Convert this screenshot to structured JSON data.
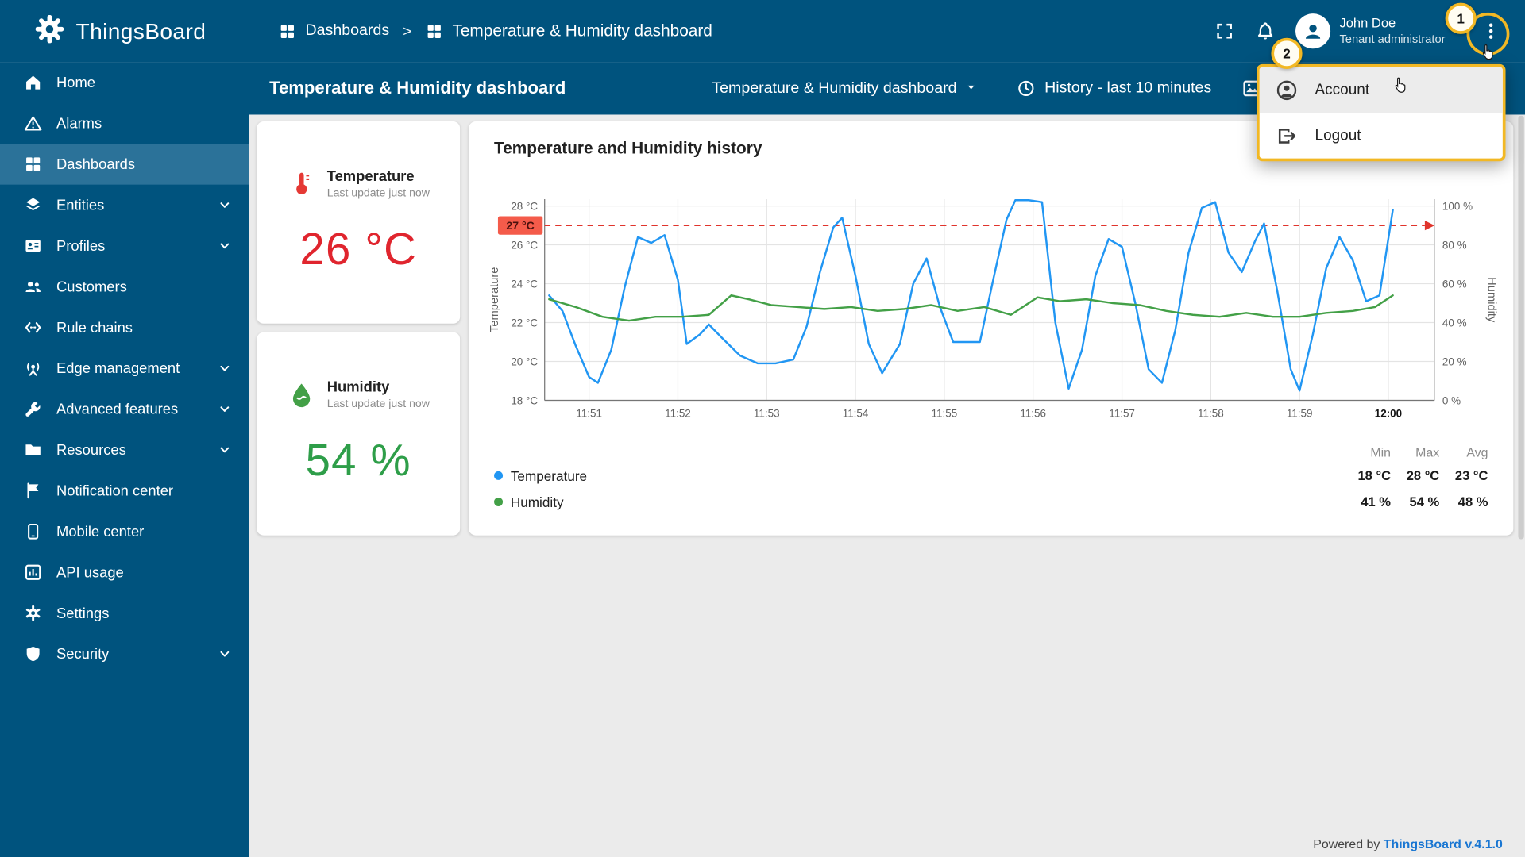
{
  "theme": {
    "primary": "#00537e",
    "sidebar_selected": "#2b7299",
    "annotation": "#f2b824",
    "content_bg": "#ebebeb",
    "link": "#1976d2"
  },
  "app": {
    "name": "ThingsBoard",
    "footer_powered": "Powered by",
    "footer_version": "ThingsBoard v.4.1.0"
  },
  "header": {
    "breadcrumb": [
      {
        "label": "Dashboards",
        "icon": "dashboards"
      },
      {
        "label": "Temperature & Humidity dashboard",
        "icon": "dashboards"
      }
    ],
    "user": {
      "name": "John Doe",
      "role": "Tenant administrator"
    }
  },
  "sidebar": {
    "items": [
      {
        "label": "Home",
        "icon": "home"
      },
      {
        "label": "Alarms",
        "icon": "alarms"
      },
      {
        "label": "Dashboards",
        "icon": "dashboards",
        "selected": true
      },
      {
        "label": "Entities",
        "icon": "entities",
        "expandable": true
      },
      {
        "label": "Profiles",
        "icon": "profiles",
        "expandable": true
      },
      {
        "label": "Customers",
        "icon": "customers"
      },
      {
        "label": "Rule chains",
        "icon": "rule-chains"
      },
      {
        "label": "Edge management",
        "icon": "edge-management",
        "expandable": true
      },
      {
        "label": "Advanced features",
        "icon": "advanced-features",
        "expandable": true
      },
      {
        "label": "Resources",
        "icon": "resources",
        "expandable": true
      },
      {
        "label": "Notification center",
        "icon": "notification-center"
      },
      {
        "label": "Mobile center",
        "icon": "mobile-center"
      },
      {
        "label": "API usage",
        "icon": "api-usage"
      },
      {
        "label": "Settings",
        "icon": "settings"
      },
      {
        "label": "Security",
        "icon": "security",
        "expandable": true
      }
    ]
  },
  "toolbar": {
    "title": "Temperature & Humidity dashboard",
    "dashboard_select": "Temperature & Humidity dashboard",
    "time_window": "History - last 10 minutes"
  },
  "user_menu": {
    "highlighted_index": 0,
    "items": [
      {
        "label": "Account",
        "icon": "account"
      },
      {
        "label": "Logout",
        "icon": "logout"
      }
    ]
  },
  "annotations": {
    "step1": "1",
    "step2": "2"
  },
  "cards": {
    "temperature": {
      "title": "Temperature",
      "subtitle": "Last update just now",
      "value": "26 °C",
      "color": "#e0252e",
      "icon_color": "#e53935"
    },
    "humidity": {
      "title": "Humidity",
      "subtitle": "Last update just now",
      "value": "54 %",
      "color": "#2e9e49",
      "icon_color": "#43a047"
    }
  },
  "chart_card": {
    "title": "Temperature and Humidity history",
    "legend": {
      "headers": [
        "Min",
        "Max",
        "Avg"
      ],
      "rows": [
        {
          "label": "Temperature",
          "color": "#2196f3",
          "min": "18 °C",
          "max": "28 °C",
          "avg": "23 °C"
        },
        {
          "label": "Humidity",
          "color": "#43a047",
          "min": "41 %",
          "max": "54 %",
          "avg": "48 %"
        }
      ]
    }
  },
  "chart_data": {
    "type": "line",
    "title": "Temperature and Humidity history",
    "x_unit": "minutes relative to 11:51",
    "x_range": [
      -0.5,
      9.52
    ],
    "x_ticks": [
      {
        "x": 0,
        "label": "11:51"
      },
      {
        "x": 1,
        "label": "11:52"
      },
      {
        "x": 2,
        "label": "11:53"
      },
      {
        "x": 3,
        "label": "11:54"
      },
      {
        "x": 4,
        "label": "11:55"
      },
      {
        "x": 5,
        "label": "11:56"
      },
      {
        "x": 6,
        "label": "11:57"
      },
      {
        "x": 7,
        "label": "11:58"
      },
      {
        "x": 8,
        "label": "11:59"
      },
      {
        "x": 9,
        "label": "12:00",
        "bold": true
      }
    ],
    "left_axis": {
      "label": "Temperature",
      "min": 18,
      "max": 28.35,
      "tick_values": [
        18,
        20,
        22,
        24,
        26,
        28
      ],
      "tick_labels": [
        "18 °C",
        "20 °C",
        "22 °C",
        "24 °C",
        "26 °C",
        "28 °C"
      ]
    },
    "right_axis": {
      "label": "Humidity",
      "min": 0,
      "max": 103.5,
      "tick_values": [
        0,
        20,
        40,
        60,
        80,
        100
      ],
      "tick_labels": [
        "0 %",
        "20 %",
        "40 %",
        "60 %",
        "80 %",
        "100 %"
      ]
    },
    "threshold": {
      "value": 27,
      "label": "27 °C",
      "color": "#e0342c",
      "badge_bg": "#f45b4a",
      "badge_text": "#4a100d"
    },
    "grid": true,
    "legend_position": "bottom",
    "series": [
      {
        "name": "Temperature",
        "unit": "°C",
        "axis": "left",
        "color": "#2196f3",
        "x": [
          -0.45,
          -0.3,
          -0.15,
          0,
          0.1,
          0.25,
          0.4,
          0.55,
          0.7,
          0.85,
          1,
          1.1,
          1.25,
          1.35,
          1.5,
          1.7,
          1.9,
          2.1,
          2.3,
          2.45,
          2.6,
          2.75,
          2.85,
          3,
          3.15,
          3.3,
          3.5,
          3.65,
          3.8,
          3.95,
          4.1,
          4.25,
          4.4,
          4.55,
          4.7,
          4.8,
          4.95,
          5.1,
          5.25,
          5.4,
          5.55,
          5.7,
          5.85,
          6,
          6.15,
          6.3,
          6.45,
          6.6,
          6.75,
          6.9,
          7.05,
          7.2,
          7.35,
          7.5,
          7.6,
          7.75,
          7.9,
          8,
          8.15,
          8.3,
          8.45,
          8.6,
          8.75,
          8.9,
          9.05
        ],
        "y": [
          23.4,
          22.6,
          20.8,
          19.2,
          18.9,
          20.6,
          23.8,
          26.4,
          26.1,
          26.5,
          24.2,
          20.9,
          21.4,
          21.9,
          21.2,
          20.3,
          19.9,
          19.9,
          20.1,
          21.8,
          24.6,
          26.9,
          27.4,
          24.4,
          20.9,
          19.4,
          20.9,
          24,
          25.3,
          22.8,
          21,
          21,
          21,
          24.2,
          27.3,
          28.3,
          28.3,
          28.2,
          22,
          18.6,
          20.6,
          24.4,
          26.3,
          25.9,
          23,
          19.6,
          18.9,
          21.6,
          25.6,
          27.9,
          28.2,
          25.6,
          24.6,
          26.2,
          27.1,
          23.6,
          19.6,
          18.5,
          21.4,
          24.8,
          26.4,
          25.2,
          23.1,
          23.4,
          27.8
        ]
      },
      {
        "name": "Humidity",
        "unit": "%",
        "axis": "right",
        "color": "#43a047",
        "x": [
          -0.45,
          -0.15,
          0.15,
          0.45,
          0.75,
          1.05,
          1.35,
          1.6,
          1.8,
          2.05,
          2.35,
          2.65,
          2.95,
          3.25,
          3.55,
          3.85,
          4.15,
          4.45,
          4.75,
          5.05,
          5.3,
          5.6,
          5.9,
          6.2,
          6.5,
          6.8,
          7.1,
          7.4,
          7.7,
          8,
          8.3,
          8.6,
          8.85,
          9.05
        ],
        "y": [
          52,
          48,
          43,
          41,
          43,
          43,
          44,
          54,
          52,
          49,
          48,
          47,
          48,
          46,
          47,
          49,
          46,
          48,
          44,
          53,
          51,
          52,
          50,
          49,
          46,
          44,
          43,
          45,
          43,
          43,
          45,
          46,
          48,
          54
        ]
      }
    ]
  }
}
